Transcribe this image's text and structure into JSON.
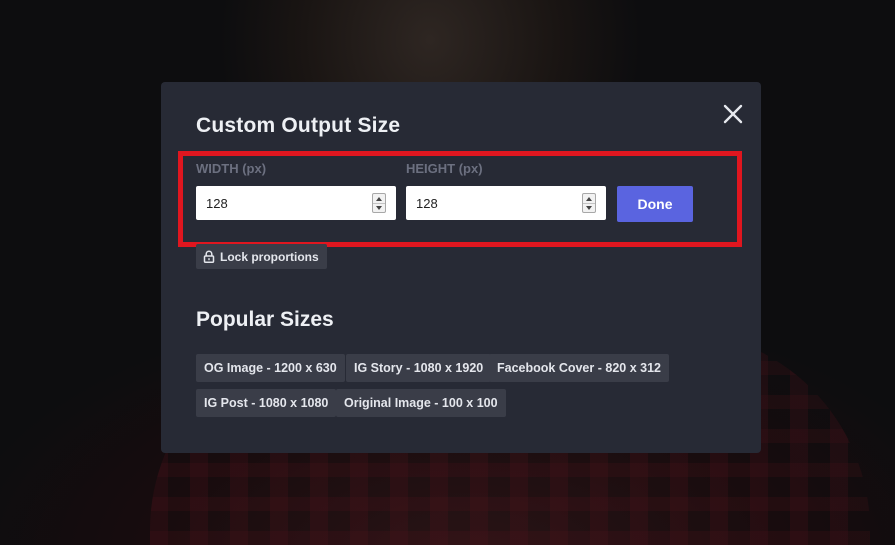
{
  "modal": {
    "title": "Custom Output Size",
    "close_icon": "close-icon",
    "width_field": {
      "label": "WIDTH (px)",
      "value": "128"
    },
    "height_field": {
      "label": "HEIGHT (px)",
      "value": "128"
    },
    "done_label": "Done",
    "lock_proportions": {
      "label": "Lock proportions",
      "icon": "lock-icon"
    },
    "popular_sizes": {
      "title": "Popular Sizes",
      "items": [
        "OG Image - 1200 x 630",
        "IG Story - 1080 x 1920",
        "Facebook Cover - 820 x 312",
        "IG Post - 1080 x 1080",
        "Original Image - 100 x 100"
      ]
    }
  },
  "colors": {
    "modal_bg": "#272a35",
    "accent": "#5a64e0",
    "highlight": "#e0161f",
    "chip_bg": "#3a3d48"
  }
}
